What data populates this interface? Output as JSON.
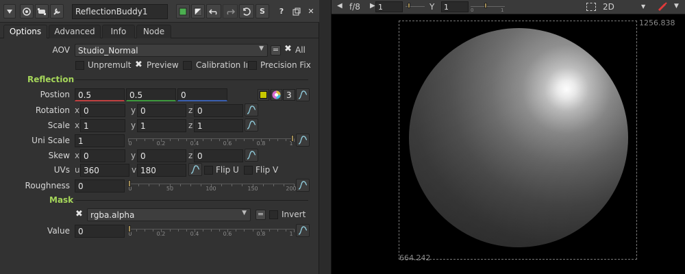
{
  "node": {
    "name": "ReflectionBuddy1",
    "icons": [
      "collapse-arrow-icon",
      "node-settings-icon",
      "python-icon",
      "wrench-icon",
      "color-swatch-icon",
      "half-swatch-icon",
      "undo-icon",
      "redo-icon",
      "revert-icon",
      "s-icon",
      "help-icon",
      "float-panel-icon",
      "close-icon"
    ],
    "help_label": "?",
    "s_label": "S",
    "close_label": "✕"
  },
  "tabs": [
    {
      "label": "Options",
      "active": true
    },
    {
      "label": "Advanced",
      "active": false
    },
    {
      "label": "Info",
      "active": false
    },
    {
      "label": "Node",
      "active": false
    }
  ],
  "aov": {
    "label": "AOV",
    "value": "Studio_Normal",
    "eq_label": "=",
    "all_label": "All",
    "all_checked": true
  },
  "options": {
    "unpremult": {
      "label": "Unpremult",
      "checked": false
    },
    "preview": {
      "label": "Preview",
      "checked": true
    },
    "calibration": {
      "label": "Calibration Iı",
      "checked": false
    },
    "precision": {
      "label": "Precision Fix",
      "checked": false
    }
  },
  "reflection": {
    "section_title": "Reflection",
    "position": {
      "label": "Postion",
      "x": "0.5",
      "y": "0.5",
      "z": "0",
      "count": "3",
      "swatch_color": "#c8c800"
    },
    "rotation": {
      "label": "Rotation",
      "x": "0",
      "y": "0",
      "z": "0"
    },
    "scale": {
      "label": "Scale",
      "x": "1",
      "y": "1",
      "z": "1"
    },
    "uni_scale": {
      "label": "Uni Scale",
      "value": "1",
      "ticks": [
        "0",
        "0.2",
        "0.4",
        "0.6",
        "0.8",
        "1"
      ],
      "level": 1.0
    },
    "skew": {
      "label": "Skew",
      "x": "0",
      "y": "0",
      "z": "0"
    },
    "uvs": {
      "label": "UVs",
      "u": "360",
      "v": "180",
      "flip_u": "Flip U",
      "flip_v": "Flip V"
    },
    "roughness": {
      "label": "Roughness",
      "value": "0",
      "ticks": [
        "0",
        "50",
        "100",
        "150",
        "200"
      ],
      "level": 0
    }
  },
  "axes": {
    "x": "x",
    "y": "y",
    "z": "z",
    "u": "u",
    "v": "v"
  },
  "mask": {
    "section_title": "Mask",
    "channel": "rgba.alpha",
    "enabled": true,
    "eq_label": "=",
    "invert_label": "Invert",
    "invert_checked": false,
    "value": {
      "label": "Value",
      "value": "0",
      "ticks": [
        "0",
        "0.2",
        "0.4",
        "0.6",
        "0.8",
        "1"
      ],
      "level": 0
    }
  },
  "viewer": {
    "frame_label": "f/8",
    "frame_value": "1",
    "gamma_label": "Y",
    "gamma_value": "1",
    "slider_ticks": [
      "0",
      "1"
    ],
    "view_mode": "2D",
    "coord_top_right": "1256.838",
    "coord_bottom_left": "664.242"
  },
  "colors": {
    "section": "#a5d65a",
    "accent_green": "#4caf50",
    "x_line": "#c04040",
    "y_line": "#3d9a3d",
    "z_line": "#3a5fb0"
  }
}
